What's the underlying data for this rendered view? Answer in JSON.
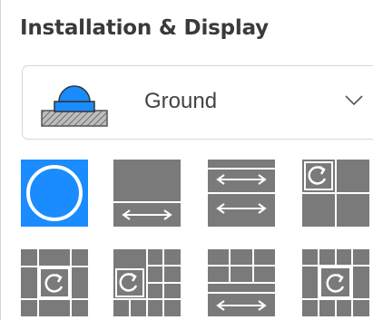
{
  "panel": {
    "title": "Installation & Display"
  },
  "mount_select": {
    "selected": "Ground",
    "icon": "ground-mount-camera-icon"
  },
  "display_modes": [
    {
      "icon": "fisheye-circle-icon",
      "selected": true
    },
    {
      "icon": "panorama-single-icon",
      "selected": false
    },
    {
      "icon": "panorama-dual-icon",
      "selected": false
    },
    {
      "icon": "quad-split-rotate-icon",
      "selected": false
    },
    {
      "icon": "center-rotate-frame-icon",
      "selected": false
    },
    {
      "icon": "rotate-six-split-icon",
      "selected": false
    },
    {
      "icon": "panorama-six-split-icon",
      "selected": false
    },
    {
      "icon": "nine-split-rotate-icon",
      "selected": false
    }
  ],
  "colors": {
    "accent": "#1a8cff",
    "tile_gray": "#7a7a7a"
  }
}
